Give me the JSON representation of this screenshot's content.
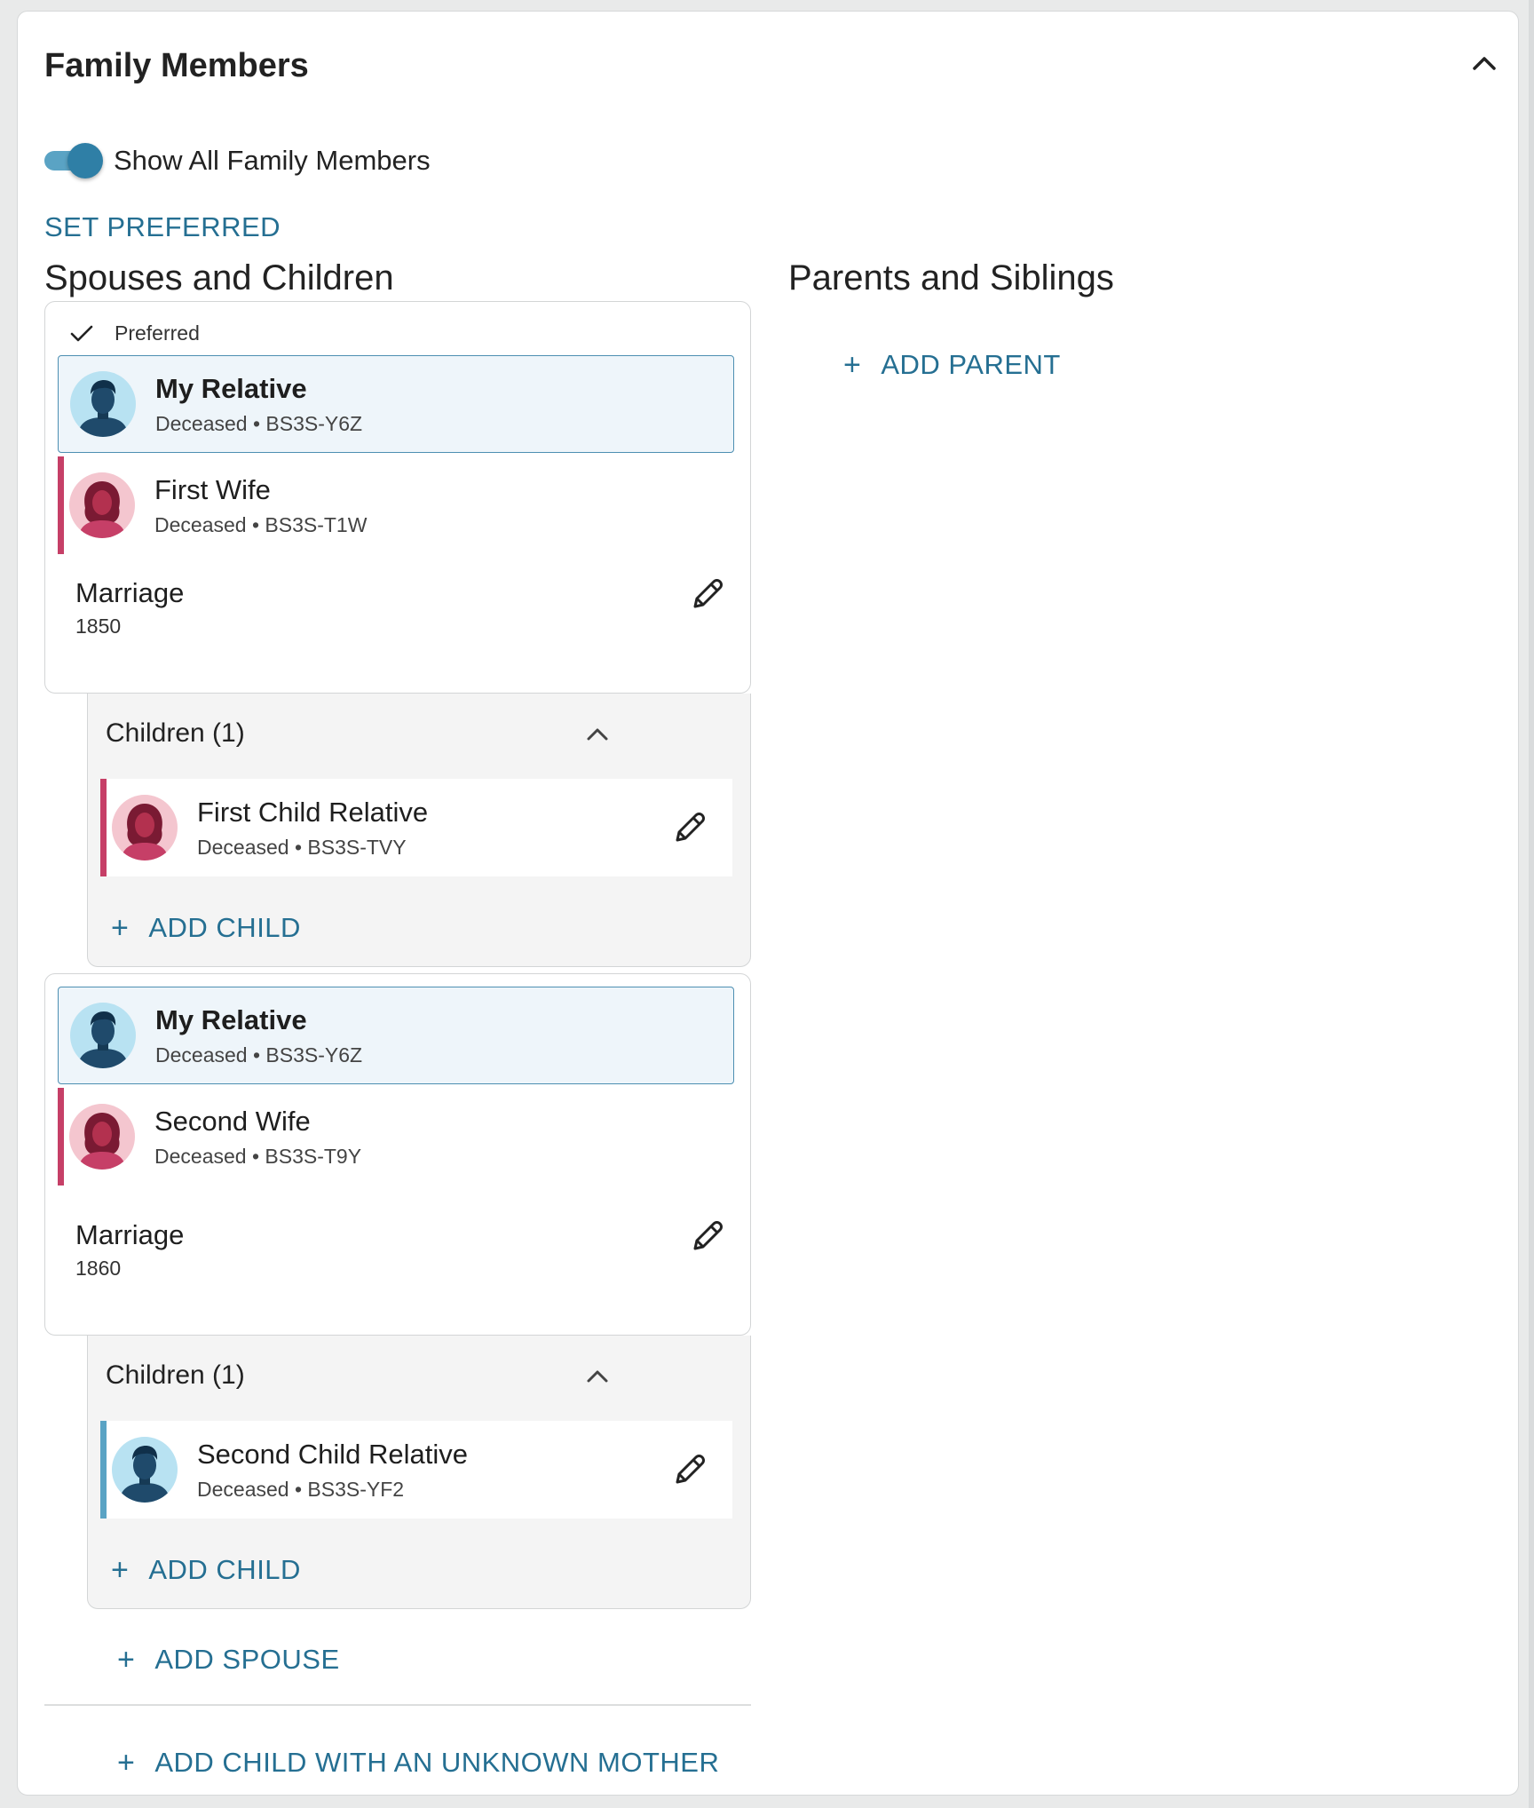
{
  "panel": {
    "title": "Family Members",
    "toggle_label": "Show All Family Members",
    "set_preferred": "SET PREFERRED"
  },
  "left": {
    "heading": "Spouses and Children",
    "families": [
      {
        "preferred_label": "Preferred",
        "focus": {
          "name": "My Relative",
          "meta": "Deceased • BS3S-Y6Z"
        },
        "spouse": {
          "name": "First Wife",
          "meta": "Deceased • BS3S-T1W"
        },
        "marriage_label": "Marriage",
        "marriage_year": "1850",
        "children_title": "Children (1)",
        "child": {
          "name": "First Child Relative",
          "meta": "Deceased • BS3S-TVY"
        },
        "add_child": "ADD CHILD"
      },
      {
        "focus": {
          "name": "My Relative",
          "meta": "Deceased • BS3S-Y6Z"
        },
        "spouse": {
          "name": "Second Wife",
          "meta": "Deceased • BS3S-T9Y"
        },
        "marriage_label": "Marriage",
        "marriage_year": "1860",
        "children_title": "Children (1)",
        "child": {
          "name": "Second Child Relative",
          "meta": "Deceased • BS3S-YF2"
        },
        "add_child": "ADD CHILD"
      }
    ],
    "add_spouse": "ADD SPOUSE",
    "add_unknown_mother": "ADD CHILD WITH AN UNKNOWN MOTHER"
  },
  "right": {
    "heading": "Parents and Siblings",
    "add_parent": "ADD PARENT"
  },
  "icons": {
    "plus": "+",
    "collapse": "chevron-up-icon",
    "edit": "pencil-icon",
    "check": "check-icon"
  },
  "colors": {
    "link": "#256f92",
    "toggle_on": "#2f7fa6",
    "female": "#c63f67",
    "male": "#5aa3c4",
    "focus_bg": "#eef5fa"
  }
}
